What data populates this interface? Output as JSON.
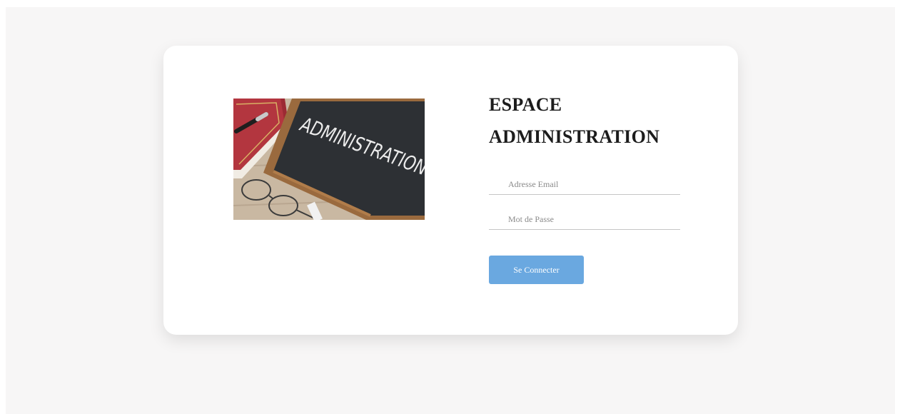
{
  "login": {
    "title_line1": "ESPACE",
    "title_line2": "ADMINISTRATION",
    "email_placeholder": "Adresse Email",
    "password_placeholder": "Mot de Passe",
    "submit_label": "Se Connecter"
  },
  "illustration": {
    "chalkboard_text": "ADMINISTRATION"
  },
  "colors": {
    "page_background": "#f7f6f6",
    "card_background": "#ffffff",
    "button": "#6aa8e0",
    "title": "#1c1c1c"
  }
}
